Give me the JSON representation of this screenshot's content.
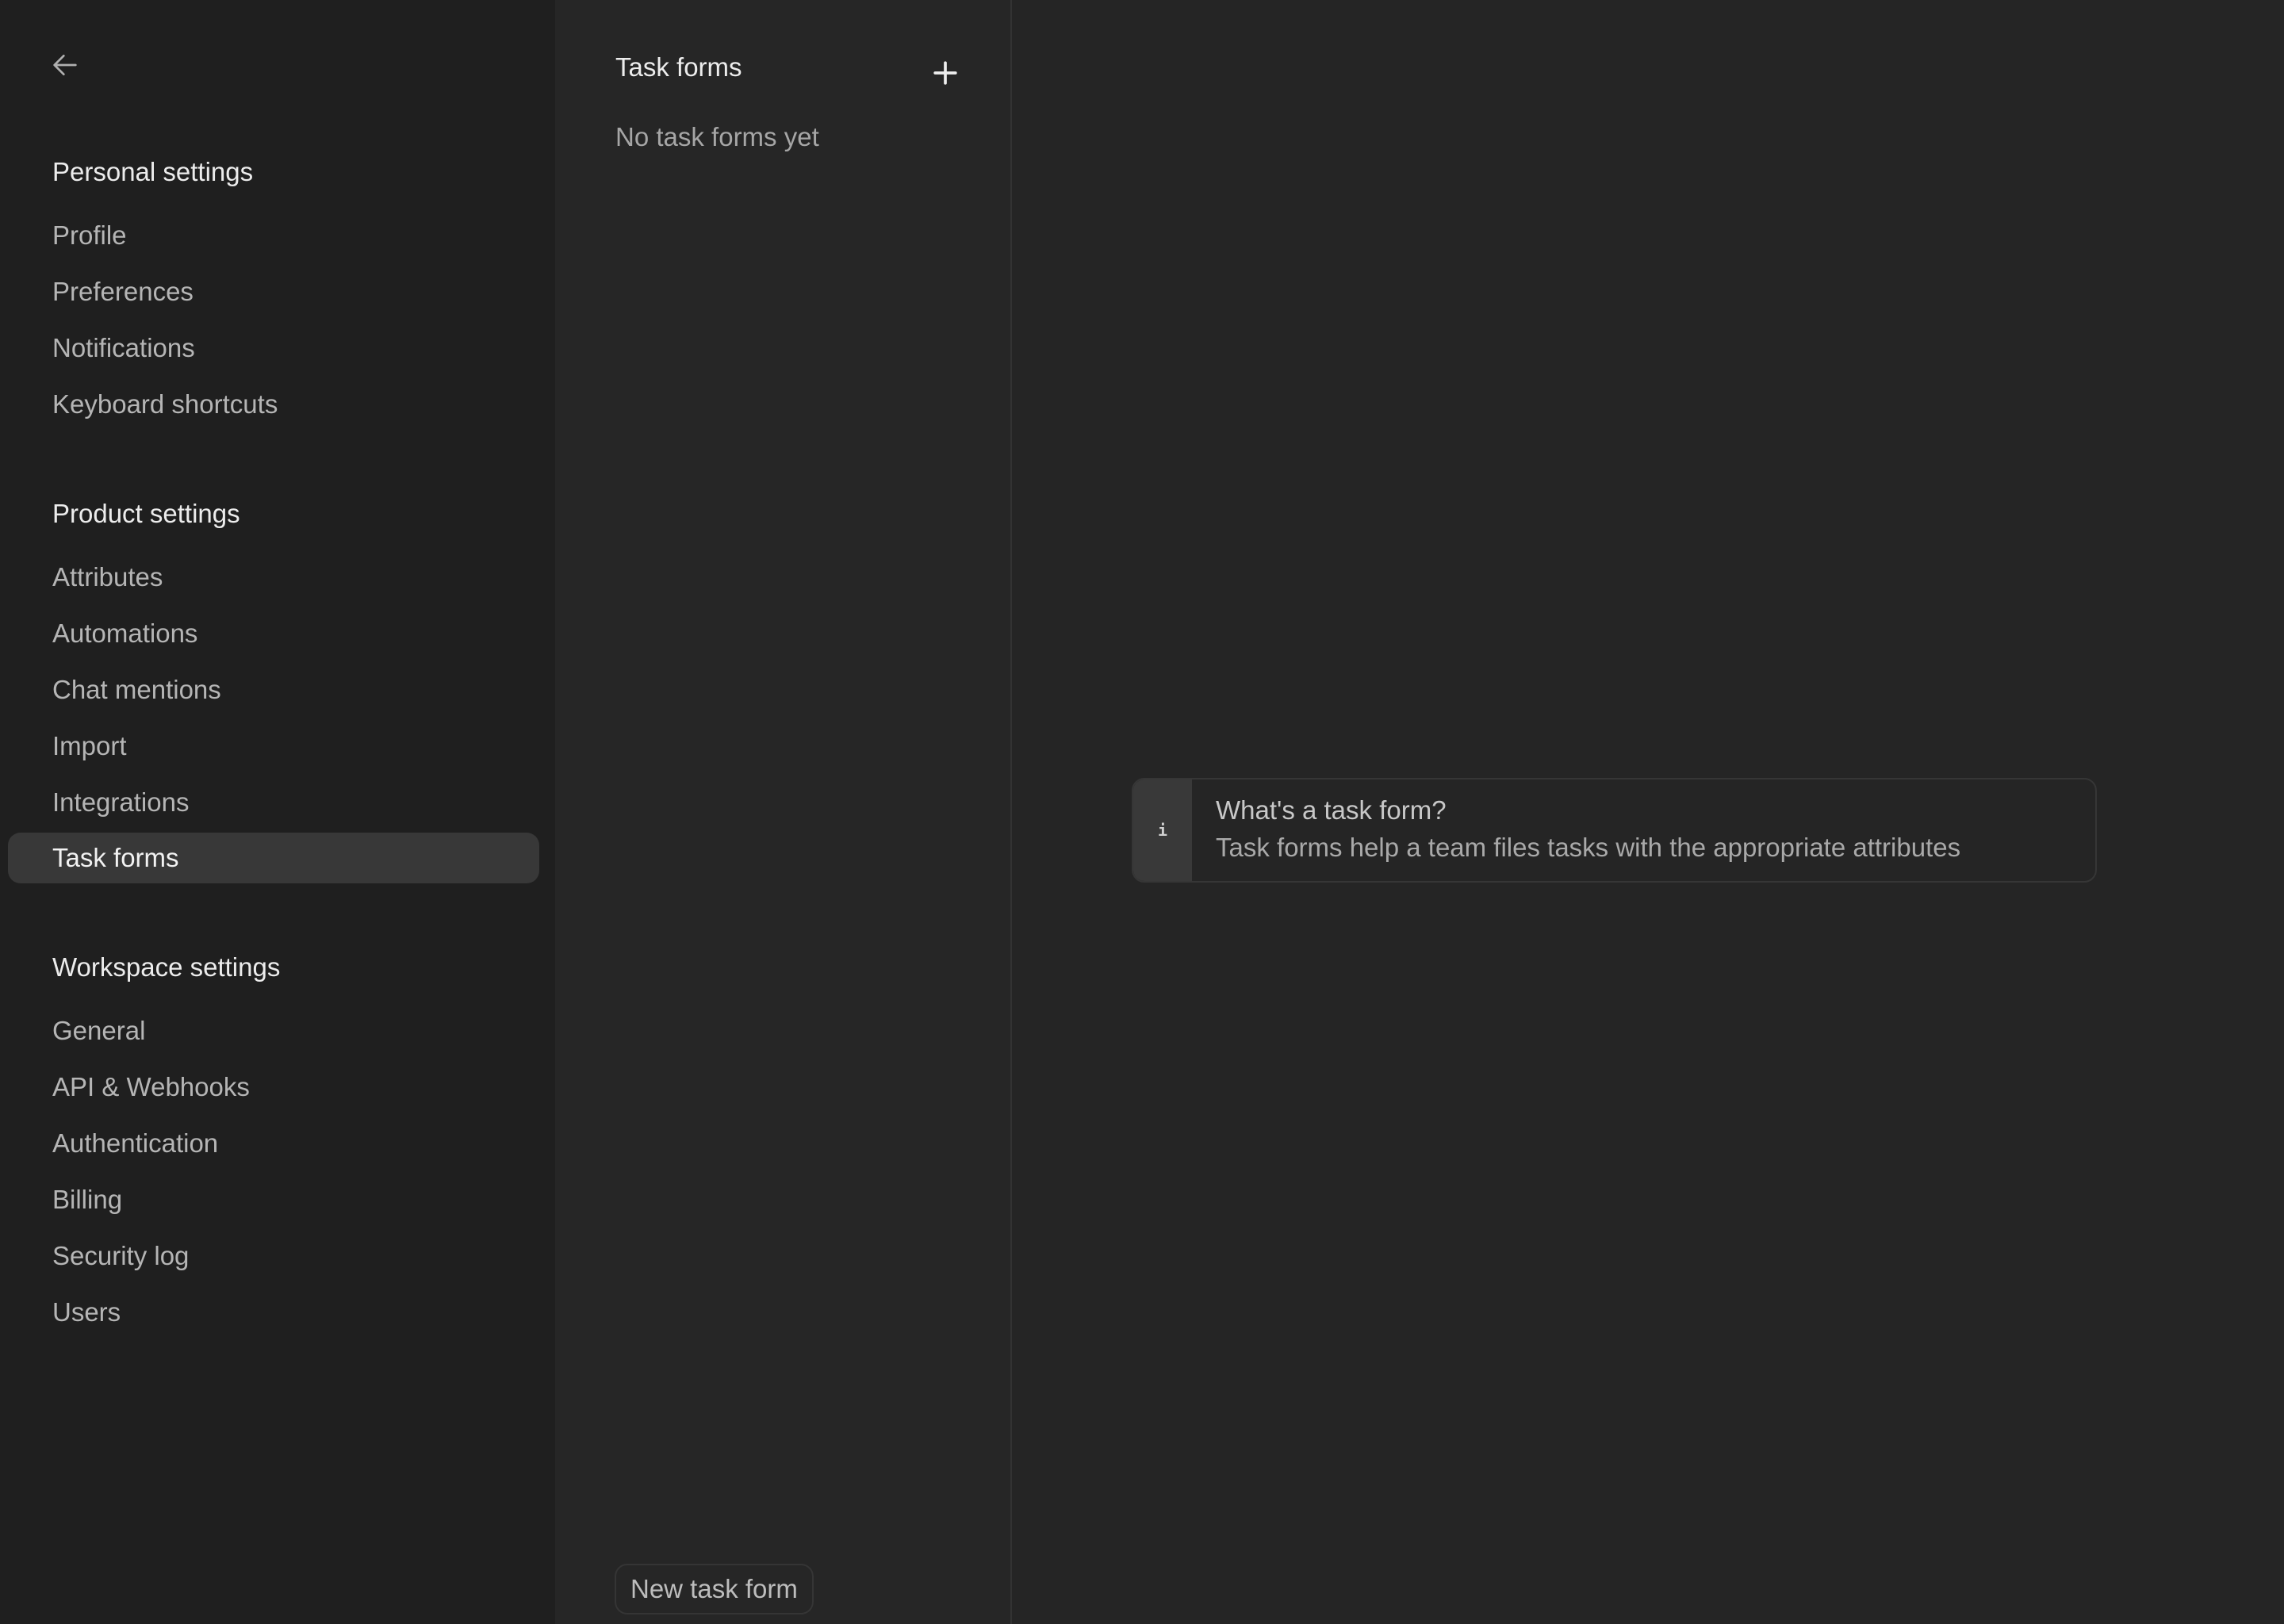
{
  "sidebar": {
    "back_icon": "arrow-left-icon",
    "sections": [
      {
        "title": "Personal settings",
        "items": [
          {
            "label": "Profile",
            "active": false
          },
          {
            "label": "Preferences",
            "active": false
          },
          {
            "label": "Notifications",
            "active": false
          },
          {
            "label": "Keyboard shortcuts",
            "active": false
          }
        ]
      },
      {
        "title": "Product settings",
        "items": [
          {
            "label": "Attributes",
            "active": false
          },
          {
            "label": "Automations",
            "active": false
          },
          {
            "label": "Chat mentions",
            "active": false
          },
          {
            "label": "Import",
            "active": false
          },
          {
            "label": "Integrations",
            "active": false
          },
          {
            "label": "Task forms",
            "active": true
          }
        ]
      },
      {
        "title": "Workspace settings",
        "items": [
          {
            "label": "General",
            "active": false
          },
          {
            "label": "API & Webhooks",
            "active": false
          },
          {
            "label": "Authentication",
            "active": false
          },
          {
            "label": "Billing",
            "active": false
          },
          {
            "label": "Security log",
            "active": false
          },
          {
            "label": "Users",
            "active": false
          }
        ]
      }
    ]
  },
  "list_panel": {
    "title": "Task forms",
    "add_icon": "plus-icon",
    "empty_text": "No task forms yet",
    "new_button_label": "New task form"
  },
  "main": {
    "info": {
      "icon_glyph": "i",
      "title": "What's a task form?",
      "text": "Task forms help a team files tasks with the appropriate attributes"
    }
  }
}
